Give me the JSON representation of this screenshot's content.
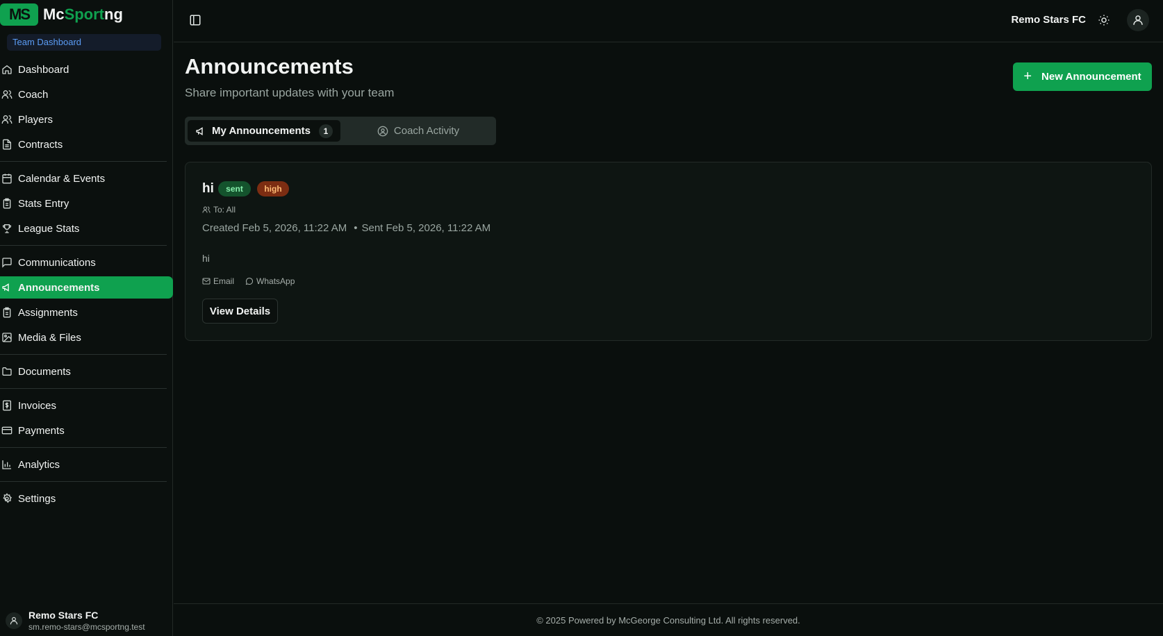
{
  "brand": {
    "logo_mark": "MS",
    "name_part1": "Mc",
    "name_part2": "Sport",
    "name_part3": "ng",
    "accent": "#0fa14f"
  },
  "sidebar": {
    "team_badge": "Team Dashboard",
    "items": [
      {
        "label": "Dashboard",
        "icon": "home-icon"
      },
      {
        "label": "Coach",
        "icon": "users-icon"
      },
      {
        "label": "Players",
        "icon": "users-icon"
      },
      {
        "label": "Contracts",
        "icon": "file-icon"
      },
      {
        "label": "Calendar & Events",
        "icon": "calendar-icon"
      },
      {
        "label": "Stats Entry",
        "icon": "clipboard-icon"
      },
      {
        "label": "League Stats",
        "icon": "trophy-icon"
      },
      {
        "label": "Communications",
        "icon": "message-icon"
      },
      {
        "label": "Announcements",
        "icon": "megaphone-icon",
        "active": true
      },
      {
        "label": "Assignments",
        "icon": "clipboard-icon"
      },
      {
        "label": "Media & Files",
        "icon": "image-icon"
      },
      {
        "label": "Documents",
        "icon": "folder-icon"
      },
      {
        "label": "Invoices",
        "icon": "dollar-icon"
      },
      {
        "label": "Payments",
        "icon": "card-icon"
      },
      {
        "label": "Analytics",
        "icon": "chart-icon"
      },
      {
        "label": "Settings",
        "icon": "gear-icon"
      }
    ],
    "user": {
      "name": "Remo Stars FC",
      "email": "sm.remo-stars@mcsportng.test"
    }
  },
  "topbar": {
    "club": "Remo Stars FC"
  },
  "page": {
    "title": "Announcements",
    "subtitle": "Share important updates with your team",
    "new_button": "New Announcement"
  },
  "tabs": {
    "my": {
      "label": "My Announcements",
      "count": "1"
    },
    "coach": {
      "label": "Coach Activity"
    }
  },
  "announcement": {
    "title": "hi",
    "status": "sent",
    "priority": "high",
    "to": "To: All",
    "created": "Created Feb 5, 2026, 11:22 AM",
    "sent": "Sent Feb 5, 2026, 11:22 AM",
    "body": "hi",
    "channels": [
      "Email",
      "WhatsApp"
    ],
    "view_button": "View Details"
  },
  "footer": {
    "text": "© 2025 Powered by McGeorge Consulting Ltd. All rights reserved."
  }
}
